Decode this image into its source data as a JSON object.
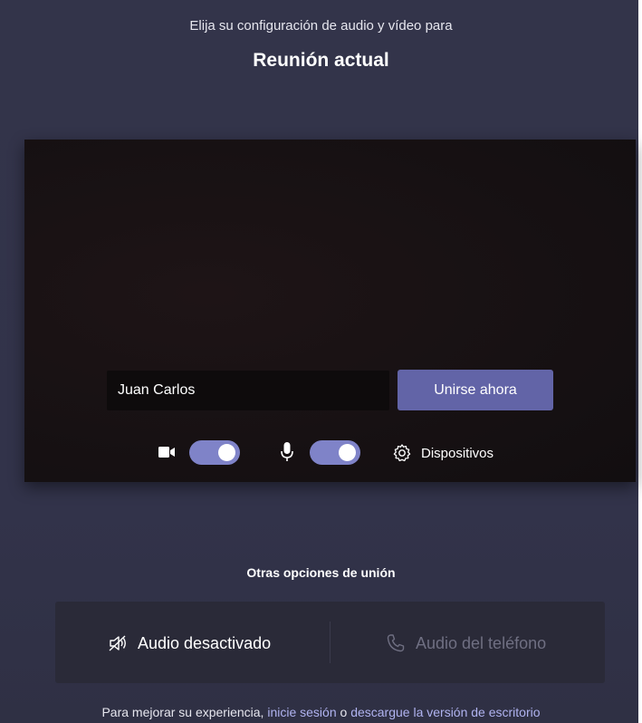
{
  "header": {
    "subtitle": "Elija su configuración de audio y vídeo para",
    "title": "Reunión actual"
  },
  "preview": {
    "name_value": "Juan Carlos",
    "join_label": "Unirse ahora",
    "video_toggle_on": true,
    "audio_toggle_on": true,
    "devices_label": "Dispositivos",
    "icons": [
      "video-camera-icon",
      "microphone-icon",
      "gear-icon"
    ]
  },
  "other_options": {
    "title": "Otras opciones de unión",
    "audio_off_label": "Audio desactivado",
    "phone_audio_label": "Audio del teléfono",
    "icons": [
      "speaker-off-icon",
      "phone-icon"
    ]
  },
  "footer": {
    "prefix": "Para mejorar su experiencia, ",
    "sign_in_link": "inicie sesión",
    "connector": " o ",
    "download_link": "descargue la versión de escritorio"
  },
  "colors": {
    "background": "#32334a",
    "accent": "#6264a7",
    "toggle": "#7f83c8",
    "link": "#b0b3f0"
  }
}
